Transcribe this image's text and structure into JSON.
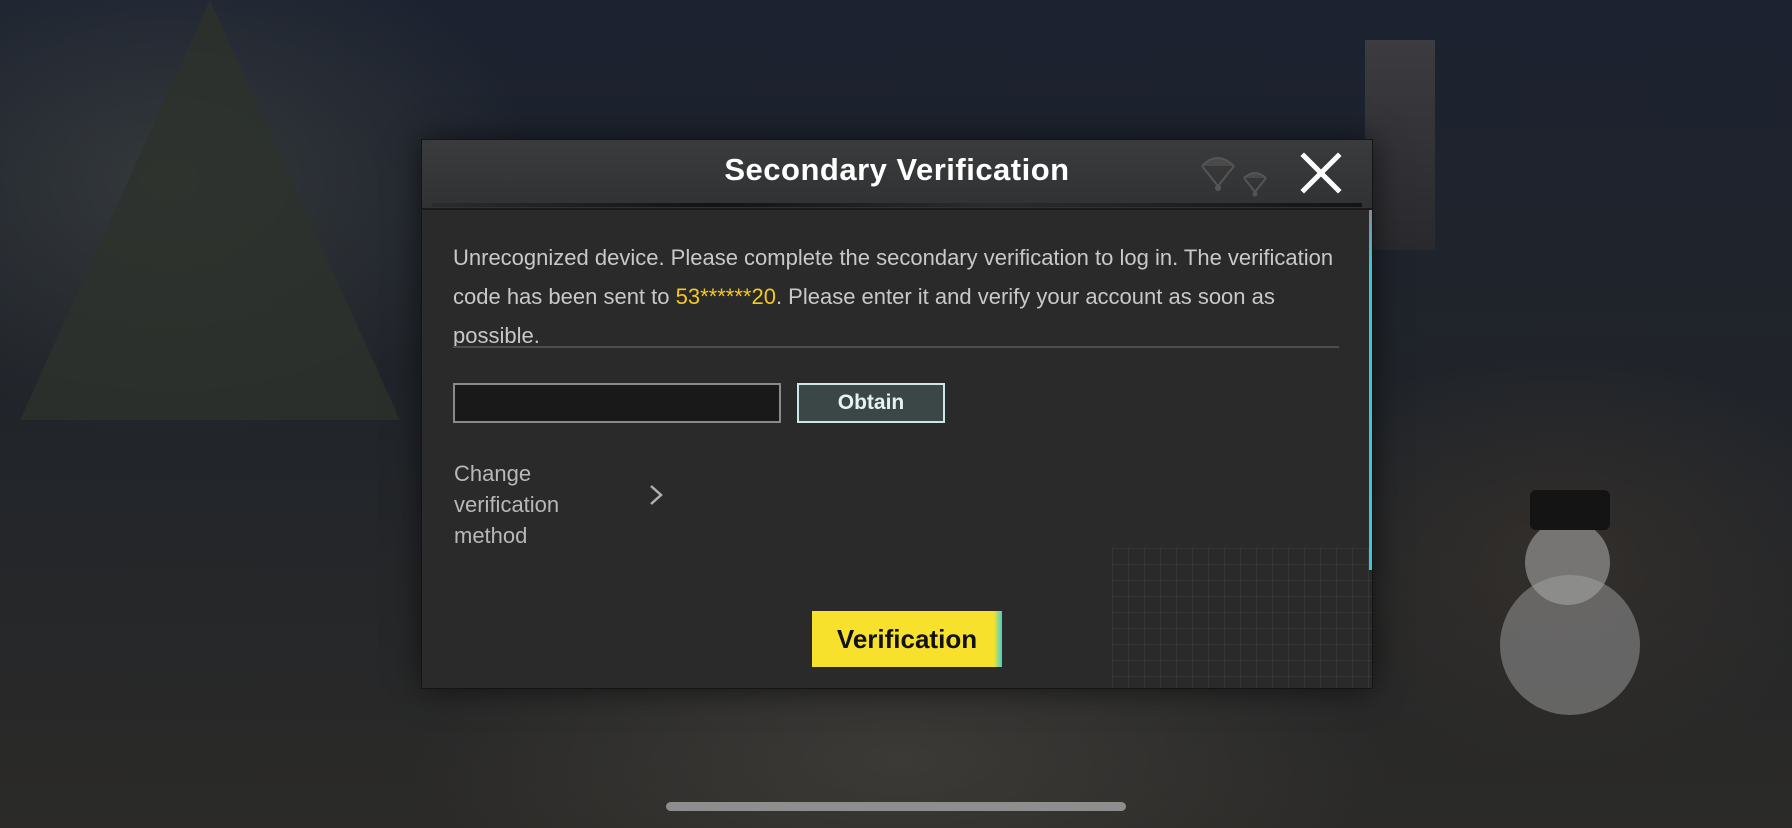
{
  "dialog": {
    "title": "Secondary Verification",
    "message_part1": "Unrecognized device. Please complete the secondary verification to log in. The verification code has been sent to ",
    "masked_number": "53******20",
    "message_part2": ". Please enter it and verify your account as soon as possible.",
    "code_input": {
      "value": "",
      "placeholder": ""
    },
    "obtain_label": "Obtain",
    "change_method_label": "Change verification method",
    "verify_label": "Verification",
    "close_icon": "close-icon",
    "header_icon": "parachute-icon",
    "change_method_icon": "chevron-right-icon"
  },
  "colors": {
    "highlight": "#f3c81f",
    "verify_button": "#f7e12c",
    "accent": "#3ec6d6"
  }
}
